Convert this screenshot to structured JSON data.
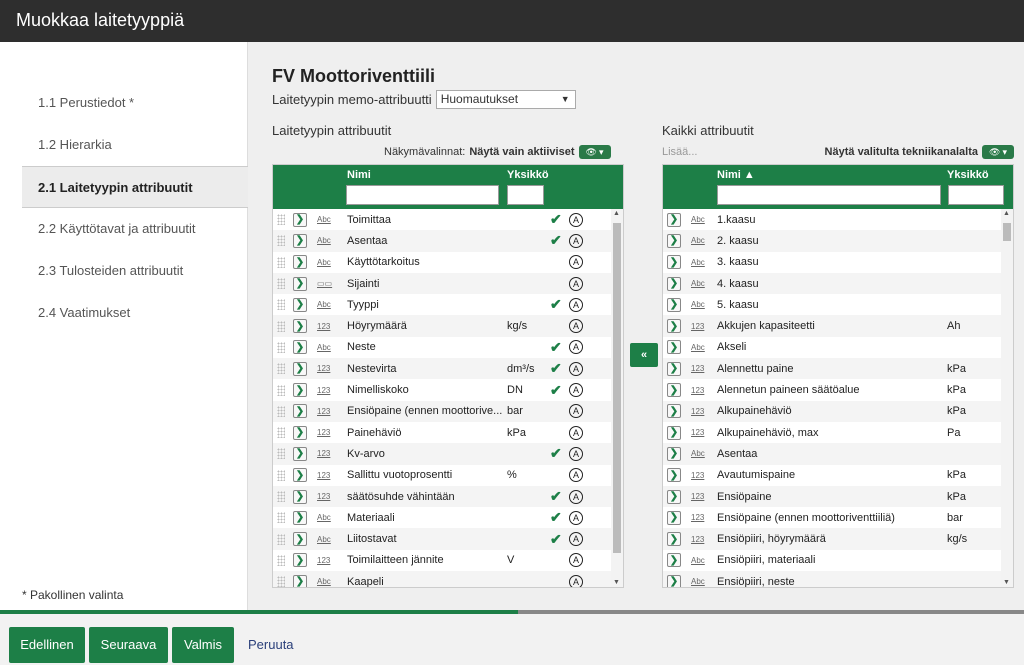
{
  "window": {
    "title": "Muokkaa laitetyyppiä"
  },
  "sidebar": {
    "items": [
      {
        "label": "1.1 Perustiedot *",
        "active": false
      },
      {
        "label": "1.2 Hierarkia",
        "active": false
      },
      {
        "label": "2.1 Laitetyypin attribuutit",
        "active": true
      },
      {
        "label": "2.2 Käyttötavat ja attribuutit",
        "active": false
      },
      {
        "label": "2.3 Tulosteiden attribuutit",
        "active": false
      },
      {
        "label": "2.4 Vaatimukset",
        "active": false
      }
    ],
    "required_note": "* Pakollinen valinta"
  },
  "main": {
    "title": "FV Moottoriventtiili",
    "memo_label": "Laitetyypin memo-attribuutti",
    "memo_value": "Huomautukset",
    "move_button_label": "«"
  },
  "left_panel": {
    "title": "Laitetyypin attribuutit",
    "view_label": "Näkymävalinnat:",
    "view_value": "Näytä vain aktiiviset",
    "col_name": "Nimi",
    "col_unit": "Yksikkö",
    "rows": [
      {
        "type": "Abc",
        "name": "Toimittaa",
        "unit": "",
        "check": true
      },
      {
        "type": "Abc",
        "name": "Asentaa",
        "unit": "",
        "check": true
      },
      {
        "type": "Abc",
        "name": "Käyttötarkoitus",
        "unit": "",
        "check": false
      },
      {
        "type": "loc",
        "name": "Sijainti",
        "unit": "",
        "check": false
      },
      {
        "type": "Abc",
        "name": "Tyyppi",
        "unit": "",
        "check": true
      },
      {
        "type": "123",
        "name": "Höyrymäärä",
        "unit": "kg/s",
        "check": false
      },
      {
        "type": "Abc",
        "name": "Neste",
        "unit": "",
        "check": true
      },
      {
        "type": "123",
        "name": "Nestevirta",
        "unit": "dm³/s",
        "check": true
      },
      {
        "type": "123",
        "name": "Nimelliskoko",
        "unit": "DN",
        "check": true
      },
      {
        "type": "123",
        "name": "Ensiöpaine (ennen moottorive...",
        "unit": "bar",
        "check": false
      },
      {
        "type": "123",
        "name": "Painehäviö",
        "unit": "kPa",
        "check": false
      },
      {
        "type": "123",
        "name": "Kv-arvo",
        "unit": "",
        "check": true
      },
      {
        "type": "123",
        "name": "Sallittu vuotoprosentti",
        "unit": "%",
        "check": false
      },
      {
        "type": "123",
        "name": "säätösuhde vähintään",
        "unit": "",
        "check": true
      },
      {
        "type": "Abc",
        "name": "Materiaali",
        "unit": "",
        "check": true
      },
      {
        "type": "Abc",
        "name": "Liitostavat",
        "unit": "",
        "check": true
      },
      {
        "type": "123",
        "name": "Toimilaitteen jännite",
        "unit": "V",
        "check": false
      },
      {
        "type": "Abc",
        "name": "Kaapeli",
        "unit": "",
        "check": false
      }
    ]
  },
  "right_panel": {
    "title": "Kaikki attribuutit",
    "add_placeholder": "Lisää...",
    "view_value": "Näytä valitulta tekniikanalalta",
    "col_name": "Nimi",
    "col_unit": "Yksikkö",
    "rows": [
      {
        "type": "Abc",
        "name": "1.kaasu",
        "unit": ""
      },
      {
        "type": "Abc",
        "name": "2. kaasu",
        "unit": ""
      },
      {
        "type": "Abc",
        "name": "3. kaasu",
        "unit": ""
      },
      {
        "type": "Abc",
        "name": "4. kaasu",
        "unit": ""
      },
      {
        "type": "Abc",
        "name": "5. kaasu",
        "unit": ""
      },
      {
        "type": "123",
        "name": "Akkujen kapasiteetti",
        "unit": "Ah"
      },
      {
        "type": "Abc",
        "name": "Akseli",
        "unit": ""
      },
      {
        "type": "123",
        "name": "Alennettu paine",
        "unit": "kPa"
      },
      {
        "type": "123",
        "name": "Alennetun paineen säätöalue",
        "unit": "kPa"
      },
      {
        "type": "123",
        "name": "Alkupainehäviö",
        "unit": "kPa"
      },
      {
        "type": "123",
        "name": "Alkupainehäviö, max",
        "unit": "Pa"
      },
      {
        "type": "Abc",
        "name": "Asentaa",
        "unit": ""
      },
      {
        "type": "123",
        "name": "Avautumispaine",
        "unit": "kPa"
      },
      {
        "type": "123",
        "name": "Ensiöpaine",
        "unit": "kPa"
      },
      {
        "type": "123",
        "name": "Ensiöpaine (ennen moottoriventtiiliä)",
        "unit": "bar"
      },
      {
        "type": "123",
        "name": "Ensiöpiiri, höyrymäärä",
        "unit": "kg/s"
      },
      {
        "type": "Abc",
        "name": "Ensiöpiiri, materiaali",
        "unit": ""
      },
      {
        "type": "Abc",
        "name": "Ensiöpiiri, neste",
        "unit": ""
      }
    ]
  },
  "footer": {
    "progress": 0.506,
    "prev_label": "Edellinen",
    "next_label": "Seuraava",
    "done_label": "Valmis",
    "cancel_label": "Peruuta"
  }
}
